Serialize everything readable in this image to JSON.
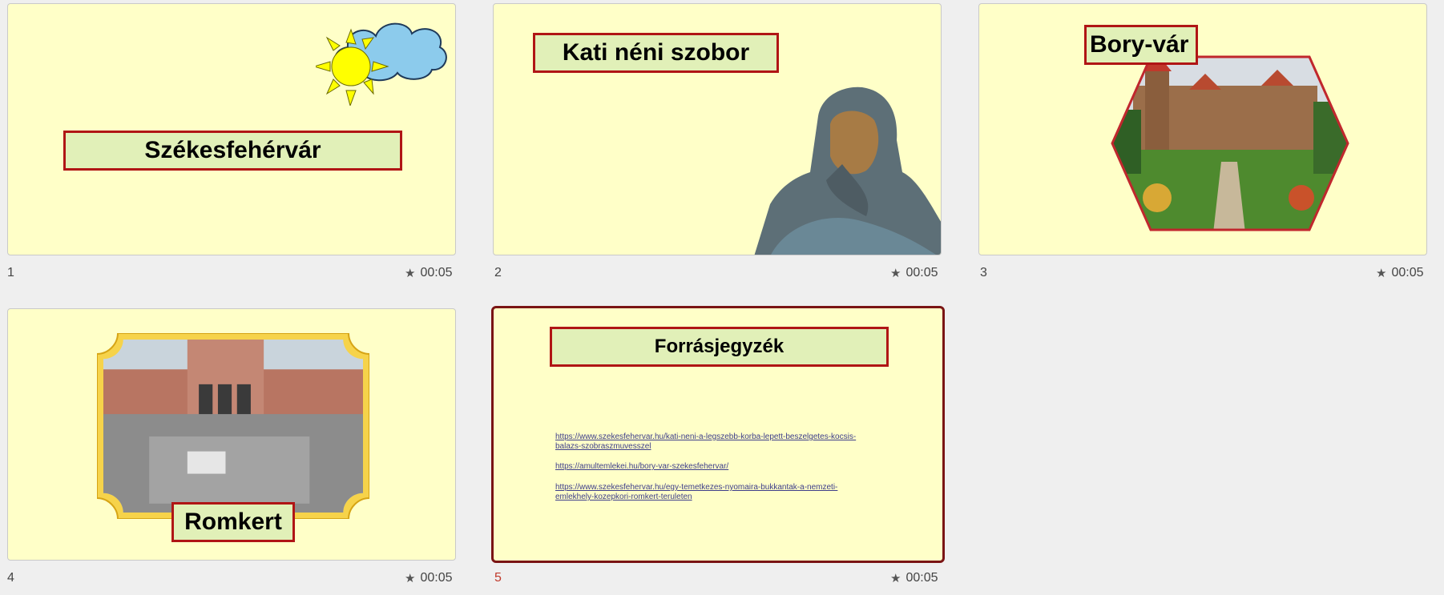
{
  "slides": [
    {
      "number": "1",
      "time": "00:05",
      "title": "Székesfehérvár"
    },
    {
      "number": "2",
      "time": "00:05",
      "title": "Kati néni szobor"
    },
    {
      "number": "3",
      "time": "00:05",
      "title": "Bory-vár"
    },
    {
      "number": "4",
      "time": "00:05",
      "title": "Romkert"
    },
    {
      "number": "5",
      "time": "00:05",
      "title": "Forrásjegyzék",
      "links": [
        "https://www.szekesfehervar.hu/kati-neni-a-legszebb-korba-lepett-beszelgetes-kocsis-",
        "balazs-szobraszmuvesszel",
        "https://amultemlekei.hu/bory-var-szekesfehervar/",
        "https://www.szekesfehervar.hu/egy-temetkezes-nyomaira-bukkantak-a-nemzeti-",
        "emlekhely-kozepkori-romkert-teruleten"
      ]
    }
  ],
  "icons": {
    "timing": "star-icon"
  },
  "colors": {
    "slide_bg": "#ffffc8",
    "title_fill": "#e1f0b8",
    "title_border": "#b01515",
    "selected_border": "#7a1414"
  }
}
